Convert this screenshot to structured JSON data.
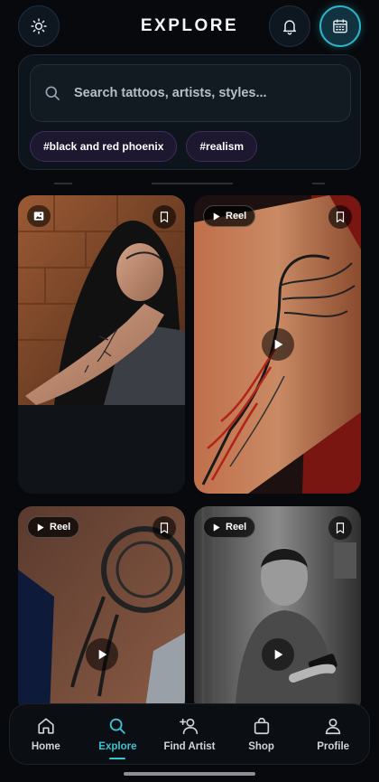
{
  "header": {
    "title": "EXPLORE",
    "theme_icon": "sun-icon",
    "notification_icon": "bell-icon",
    "calendar_icon": "calendar-icon",
    "accent_color": "#2bb6c8"
  },
  "search": {
    "placeholder": "Search tattoos, artists, styles...",
    "value": "",
    "icon": "search-icon",
    "chips": [
      "#black and red phoenix",
      "#realism"
    ]
  },
  "feed": {
    "items": [
      {
        "type": "image",
        "badge_icon": "image-icon",
        "bookmark_icon": "bookmark-icon",
        "description": ""
      },
      {
        "type": "reel",
        "badge_label": "Reel",
        "badge_icon": "play-icon",
        "bookmark_icon": "bookmark-icon"
      },
      {
        "type": "reel",
        "badge_label": "Reel",
        "badge_icon": "play-icon",
        "bookmark_icon": "bookmark-icon"
      },
      {
        "type": "reel",
        "badge_label": "Reel",
        "badge_icon": "play-icon",
        "bookmark_icon": "bookmark-icon"
      }
    ]
  },
  "bottom_nav": {
    "items": [
      {
        "label": "Home",
        "icon": "home-icon",
        "active": false
      },
      {
        "label": "Explore",
        "icon": "search-icon",
        "active": true
      },
      {
        "label": "Find Artist",
        "icon": "add-person-icon",
        "active": false
      },
      {
        "label": "Shop",
        "icon": "shopping-bag-icon",
        "active": false
      },
      {
        "label": "Profile",
        "icon": "person-icon",
        "active": false
      }
    ],
    "active_color": "#3cc3d4"
  }
}
